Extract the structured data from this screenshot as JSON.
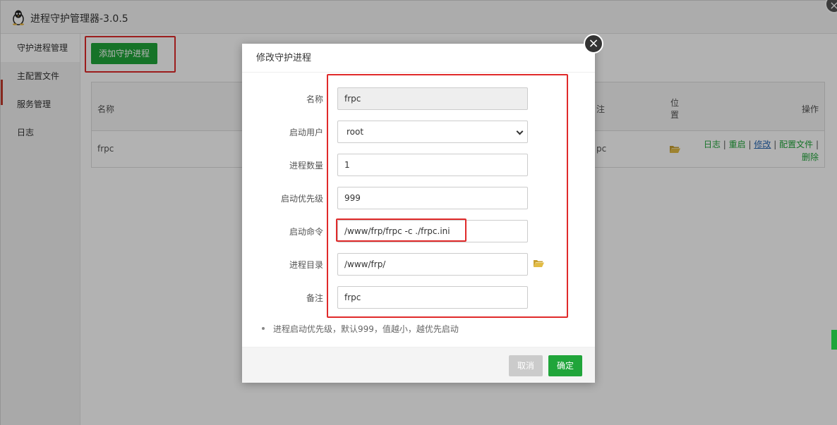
{
  "app": {
    "title": "进程守护管理器-3.0.5"
  },
  "sidebar": {
    "items": [
      {
        "label": "守护进程管理"
      },
      {
        "label": "主配置文件"
      },
      {
        "label": "服务管理"
      },
      {
        "label": "日志"
      }
    ]
  },
  "toolbar": {
    "add_label": "添加守护进程"
  },
  "table": {
    "headers": {
      "name": "名称",
      "remark": "注",
      "location_1": "位",
      "location_2": "置",
      "ops": "操作"
    },
    "row": {
      "name": "frpc",
      "remark": "pc",
      "ops": {
        "log": "日志",
        "restart": "重启",
        "edit": "修改",
        "config": "配置文件",
        "delete": "删除",
        "sep": "|"
      }
    }
  },
  "modal": {
    "title": "修改守护进程",
    "fields": {
      "name": {
        "label": "名称",
        "value": "frpc"
      },
      "user": {
        "label": "启动用户",
        "value": "root"
      },
      "count": {
        "label": "进程数量",
        "value": "1"
      },
      "priority": {
        "label": "启动优先级",
        "value": "999"
      },
      "command": {
        "label": "启动命令",
        "value": "/www/frp/frpc -c ./frpc.ini"
      },
      "dir": {
        "label": "进程目录",
        "value": "/www/frp/"
      },
      "remark": {
        "label": "备注",
        "value": "frpc"
      }
    },
    "tip": "进程启动优先级，默认999，值越小，越优先启动",
    "cancel_label": "取消",
    "ok_label": "确定"
  },
  "colors": {
    "accent": "#20a53a",
    "highlight": "#e02a2a",
    "link": "#2a6ab5",
    "folder": "#d7b13b"
  },
  "icons": {
    "logo": "penguin-icon",
    "folder": "folder-open-icon",
    "close": "close-icon"
  }
}
